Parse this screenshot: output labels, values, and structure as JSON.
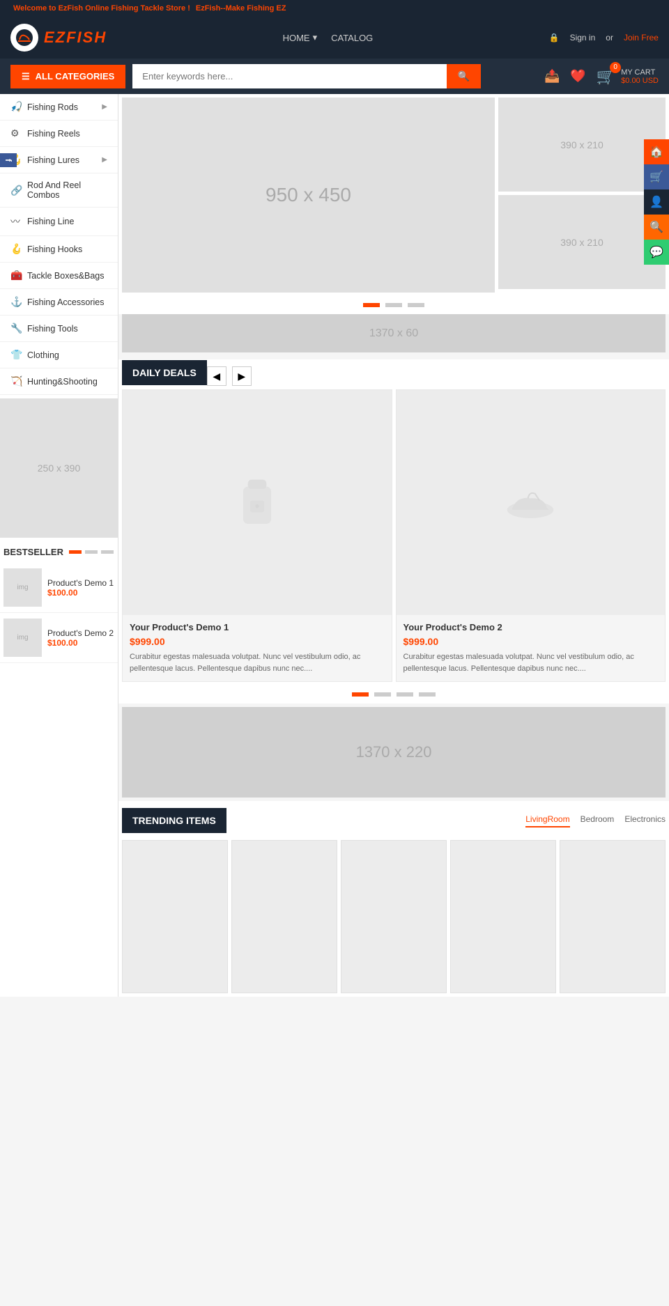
{
  "topbar": {
    "welcome": "Welcome to EzFish Online Fishing Tackle Store !",
    "tagline": "EzFish--Make Fishing EZ"
  },
  "header": {
    "logo_text": "EZFISH",
    "nav": [
      {
        "label": "HOME",
        "has_arrow": true
      },
      {
        "label": "CATALOG",
        "has_arrow": false
      }
    ],
    "auth": {
      "signin": "Sign in",
      "or": "or",
      "join": "Join Free"
    }
  },
  "toolbar": {
    "all_categories": "ALL CATEGORIES",
    "search_placeholder": "Enter keywords here...",
    "cart_label": "MY CART",
    "cart_price": "$0.00 USD",
    "cart_count": "0"
  },
  "sidebar": {
    "items": [
      {
        "label": "Fishing Rods",
        "has_arrow": true,
        "icon": "🎣"
      },
      {
        "label": "Fishing Reels",
        "has_arrow": false,
        "icon": "⚙️"
      },
      {
        "label": "Fishing Lures",
        "has_arrow": true,
        "icon": "🪝"
      },
      {
        "label": "Rod And Reel Combos",
        "has_arrow": false,
        "icon": "🔗"
      },
      {
        "label": "Fishing Line",
        "has_arrow": false,
        "icon": "〰️"
      },
      {
        "label": "Fishing Hooks",
        "has_arrow": false,
        "icon": "🪝"
      },
      {
        "label": "Tackle Boxes&Bags",
        "has_arrow": false,
        "icon": "🧰"
      },
      {
        "label": "Fishing Accessories",
        "has_arrow": false,
        "icon": "⚓"
      },
      {
        "label": "Fishing Tools",
        "has_arrow": false,
        "icon": "🔧"
      },
      {
        "label": "Clothing",
        "has_arrow": false,
        "icon": "👕"
      },
      {
        "label": "Hunting&Shooting",
        "has_arrow": false,
        "icon": "🏹"
      }
    ]
  },
  "hero": {
    "main_size": "950 x 450",
    "side1_size": "390 x 210",
    "side2_size": "390 x 210"
  },
  "banners": {
    "strip1": "1370 x 60",
    "big": "1370 x 220"
  },
  "daily_deals": {
    "title": "DAILY DEALS",
    "products": [
      {
        "title": "Your Product's Demo 1",
        "price": "$999.00",
        "desc": "Curabitur egestas malesuada volutpat. Nunc vel vestibulum odio, ac pellentesque lacus. Pellentesque dapibus nunc nec...."
      },
      {
        "title": "Your Product's Demo 2",
        "price": "$999.00",
        "desc": "Curabitur egestas malesuada volutpat. Nunc vel vestibulum odio, ac pellentesque lacus. Pellentesque dapibus nunc nec...."
      }
    ]
  },
  "sidebar_ad": {
    "size": "250 x 390"
  },
  "bestseller": {
    "title": "BESTSELLER",
    "products": [
      {
        "name": "Product's Demo 1",
        "price": "$100.00"
      },
      {
        "name": "Product's Demo 2",
        "price": "$100.00"
      }
    ]
  },
  "trending": {
    "title": "TRENDING ITEMS",
    "tabs": [
      {
        "label": "LivingRoom",
        "active": true
      },
      {
        "label": "Bedroom",
        "active": false
      },
      {
        "label": "Electronics",
        "active": false
      }
    ]
  }
}
